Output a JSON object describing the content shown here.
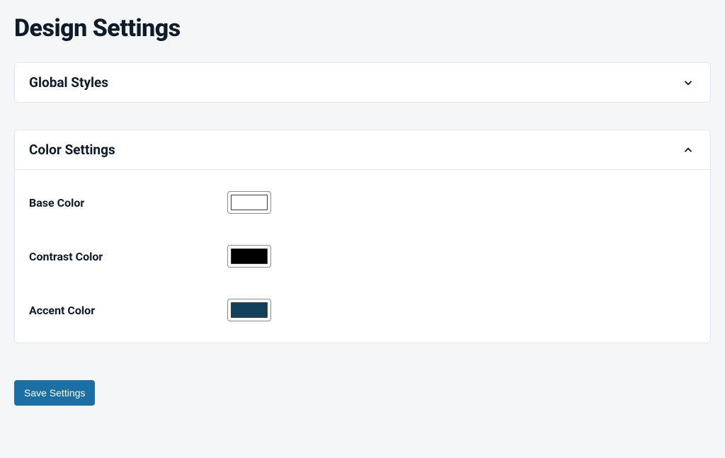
{
  "page": {
    "title": "Design Settings"
  },
  "sections": {
    "global_styles": {
      "title": "Global Styles",
      "expanded": false
    },
    "color_settings": {
      "title": "Color Settings",
      "expanded": true,
      "fields": {
        "base_color": {
          "label": "Base Color",
          "value": "#ffffff"
        },
        "contrast_color": {
          "label": "Contrast Color",
          "value": "#000000"
        },
        "accent_color": {
          "label": "Accent Color",
          "value": "#13405a"
        }
      }
    }
  },
  "actions": {
    "save_label": "Save Settings"
  }
}
